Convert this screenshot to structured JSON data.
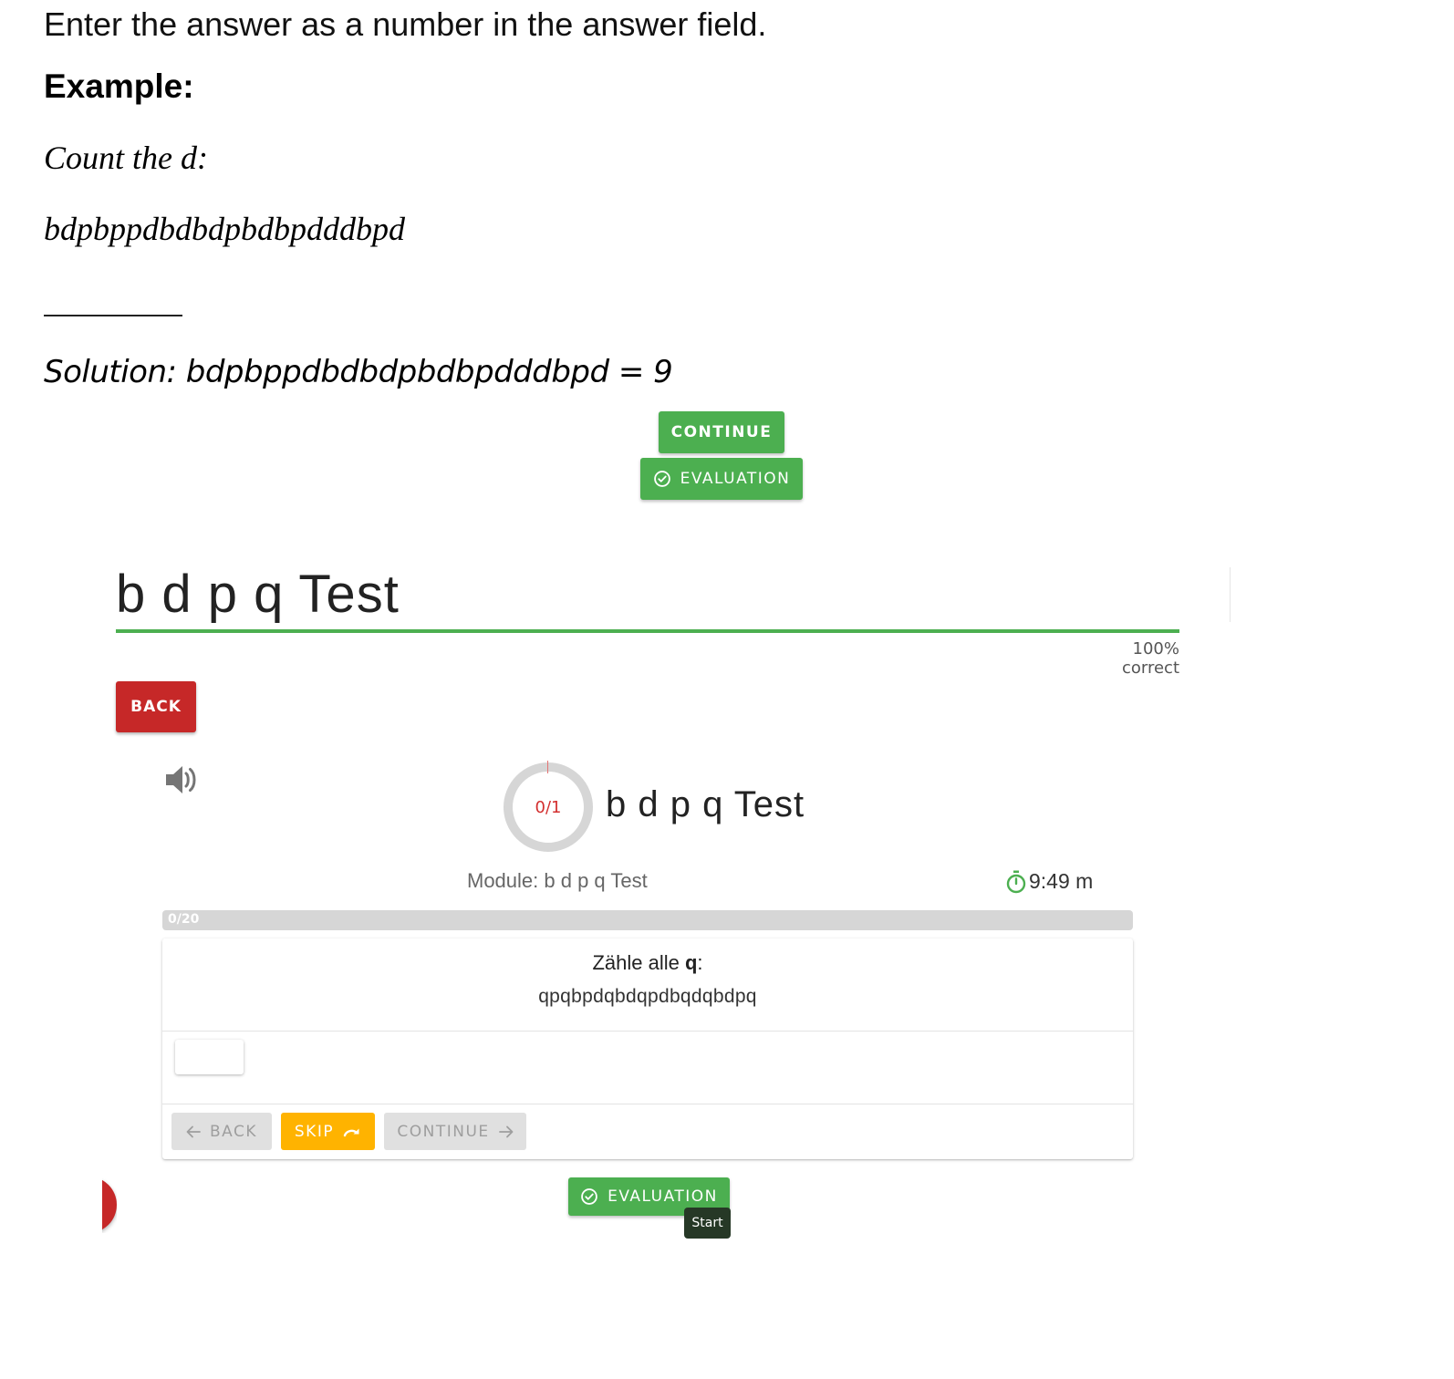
{
  "instructions": {
    "heading": "Enter the answer as a number in the answer field.",
    "example_label": "Example:",
    "count_prompt": "Count the d:",
    "example_letters": "bdpbppdbdbdpbdbpdddbpd",
    "solution": "Solution: bdpbppdbdbdpbdbpdddbpd = 9"
  },
  "top_buttons": {
    "continue_label": "CONTINUE",
    "evaluation_label": "EVALUATION"
  },
  "app": {
    "title": "b d p q Test",
    "correct_text": "100% correct",
    "back_label": "BACK",
    "ring_label": "0/1",
    "ring_fraction": 0,
    "quiz_title": "b d p q Test",
    "module_text": "Module: b d p q Test",
    "timer_text": "9:49 m",
    "progress_label": "0/20",
    "progress_fraction": 0,
    "question": {
      "prefix": "Zähle alle ",
      "target_letter": "q",
      "suffix": ":",
      "letters": "qpqbpdqbdqpdbqdqbdpq"
    },
    "answer_value": "",
    "nav": {
      "back_label": "BACK",
      "skip_label": "SKIP",
      "continue_label": "CONTINUE"
    },
    "evaluation_label": "EVALUATION",
    "tooltip": "Start"
  },
  "colors": {
    "green": "#4caf50",
    "red": "#c62828",
    "amber": "#ffb300",
    "grey": "#e0e0e0"
  },
  "icons": [
    "check-circle-icon",
    "speaker-icon",
    "timer-icon",
    "arrow-left-icon",
    "redo-icon",
    "arrow-right-icon"
  ]
}
